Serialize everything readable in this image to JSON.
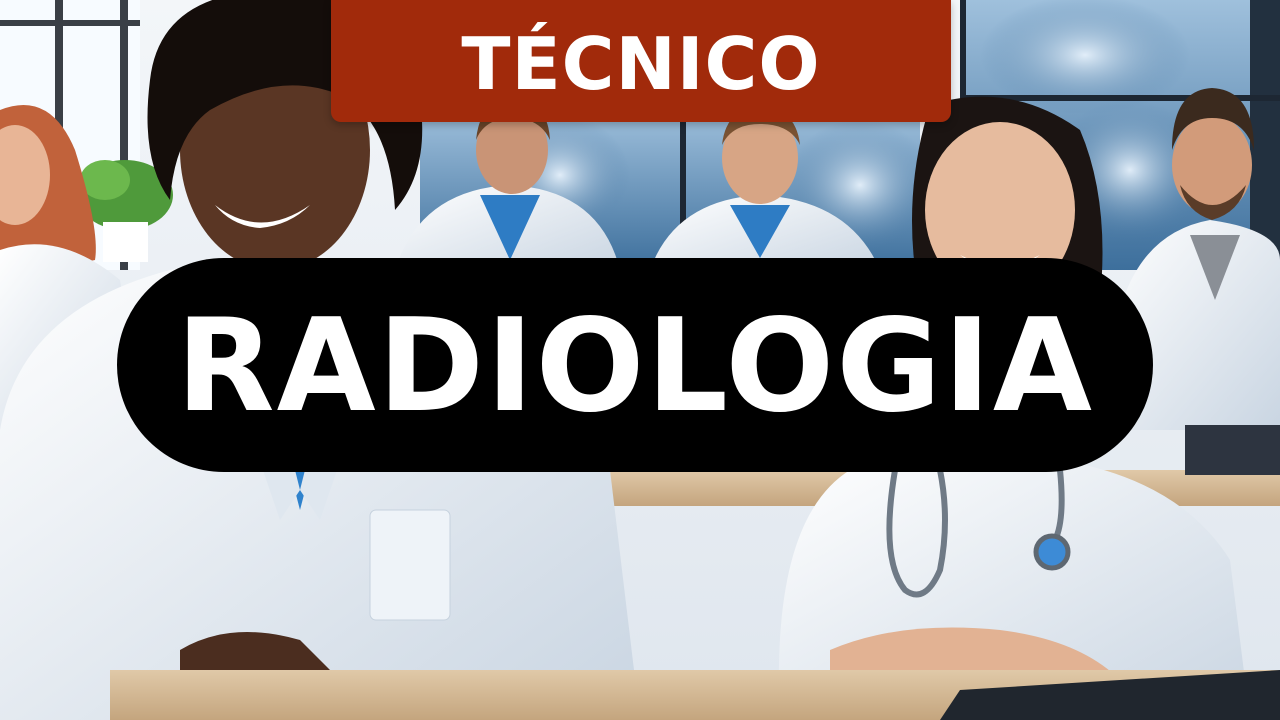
{
  "badge": {
    "text": "TÉCNICO",
    "color": "#a12a0b"
  },
  "headline": {
    "text": "RADIOLOGIA",
    "color": "#000000"
  },
  "scene": {
    "description_icons": [
      "classroom-photo",
      "xray-lightbox",
      "stethoscope-icon"
    ]
  }
}
